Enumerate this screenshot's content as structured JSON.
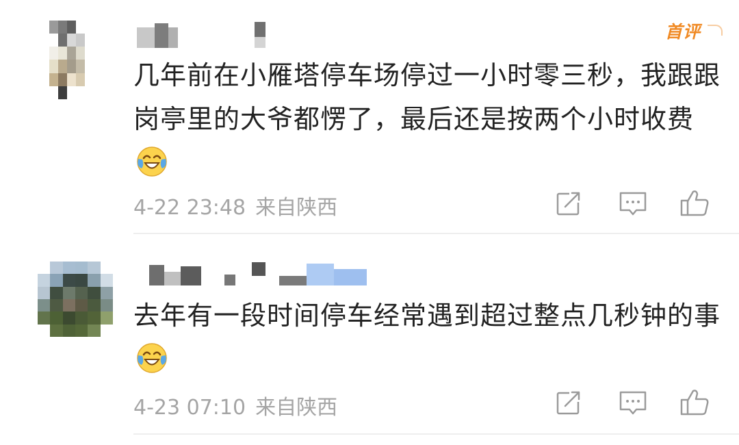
{
  "comments": [
    {
      "badge": "首评",
      "text": "几年前在小雁塔停车场停过一小时零三秒，我跟跟岗亭里的大爷都愣了，最后还是按两个小时收费",
      "emoji": "laughing-crying-emoji",
      "date": "4-22 23:48",
      "location": "来自陕西",
      "actions": [
        "repost-icon",
        "comment-icon",
        "like-icon"
      ]
    },
    {
      "text": "去年有一段时间停车经常遇到超过整点几秒钟的事",
      "emoji": "laughing-crying-emoji",
      "date": "4-23 07:10",
      "location": "来自陕西",
      "actions": [
        "repost-icon",
        "comment-icon",
        "like-icon"
      ]
    }
  ],
  "colors": {
    "text": "#222222",
    "meta": "#a5a5a5",
    "badge": "#f08a24",
    "icon": "#9a9a9a",
    "divider": "#eeeeee"
  }
}
